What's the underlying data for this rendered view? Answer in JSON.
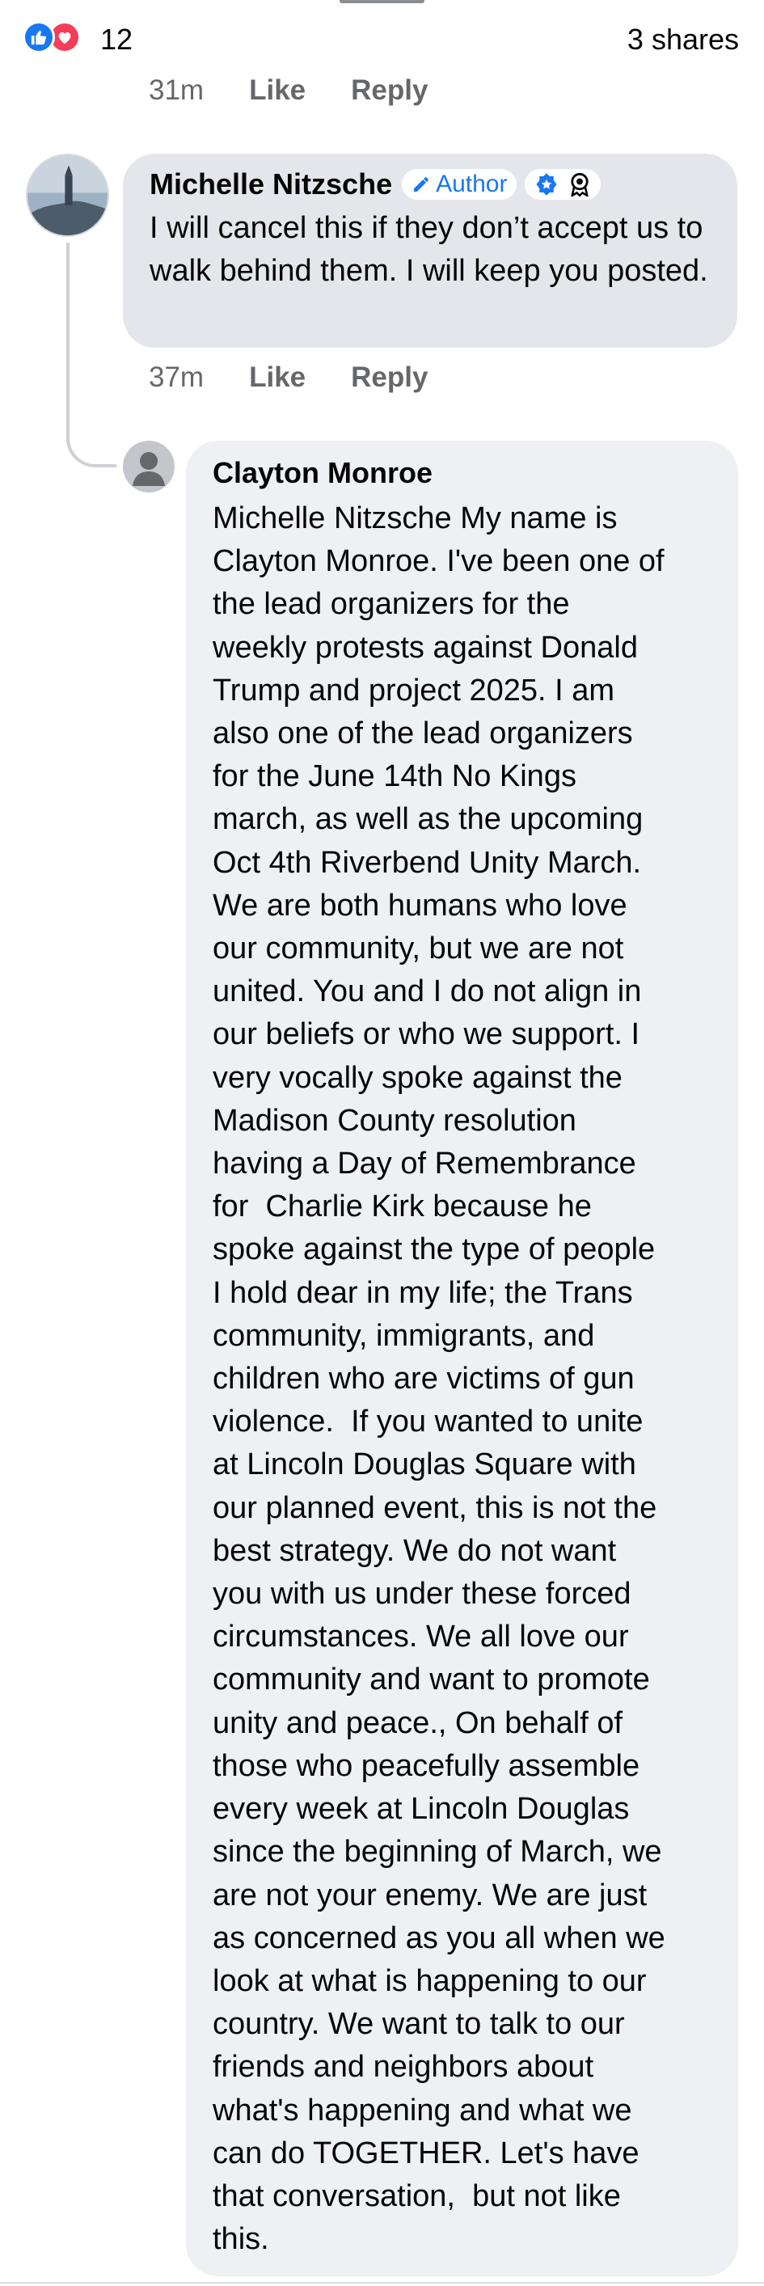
{
  "reactions": {
    "count": "12",
    "shares": "3 shares"
  },
  "top_meta": {
    "time": "31m",
    "like": "Like",
    "reply": "Reply"
  },
  "comment_michelle": {
    "name": "Michelle Nitzsche",
    "badge": "Author",
    "text": "I will cancel this if they don’t accept us to walk behind them. I will keep you posted.",
    "time": "37m",
    "like": "Like",
    "reply": "Reply"
  },
  "comment_clayton": {
    "name": "Clayton Monroe",
    "lines": [
      "Michelle Nitzsche My name is",
      "Clayton Monroe. I've been one of",
      "the lead organizers for the",
      "weekly protests against Donald",
      "Trump and project 2025. I am",
      "also one of the lead organizers",
      "for the June 14th No Kings",
      "march, as well as the upcoming",
      "Oct 4th Riverbend Unity March.",
      "We are both humans who love",
      "our community, but we are not",
      "united. You and I do not align in",
      "our beliefs or who we support. I",
      "very vocally spoke against the",
      "Madison County resolution",
      "having a Day of Remembrance",
      "for  Charlie Kirk because he",
      "spoke against the type of people",
      "I hold dear in my life; the Trans",
      "community, immigrants, and",
      "children who are victims of gun",
      "violence.  If you wanted to unite",
      "at Lincoln Douglas Square with",
      "our planned event, this is not the",
      "best strategy. We do not want",
      "you with us under these forced",
      "circumstances. We all love our",
      "community and want to promote",
      "unity and peace., On behalf of",
      "those who peacefully assemble",
      "every week at Lincoln Douglas",
      "since the beginning of March, we",
      "are not your enemy. We are just",
      "as concerned as you all when we",
      "look at what is happening to our",
      "country. We want to talk to our",
      "friends and neighbors about",
      "what's happening and what we",
      "can do TOGETHER. Let's have",
      "that conversation,  but not like",
      "this."
    ]
  },
  "colors": {
    "like_blue": "#1877f2",
    "love_red": "#f33e58",
    "meta_gray": "#65676b"
  }
}
